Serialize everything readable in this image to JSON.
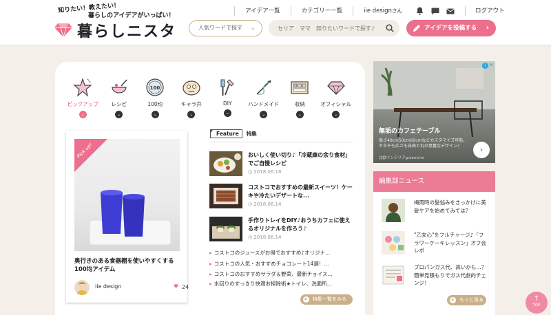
{
  "header": {
    "tagline1": "知りたい！教えたい！",
    "tagline2": "暮らしのアイデアがいっぱい！",
    "logo": "暮らしニスタ",
    "nav_ideas": "アイデア一覧",
    "nav_categories": "カテゴリー一覧",
    "user_name": "iie design",
    "user_suffix": "さん",
    "logout": "ログアウト",
    "keyword_select": "人気ワードで探す",
    "search_placeholder": "セリア　ママ　知りたいワードで探す♪",
    "post_button": "アイデアを投稿する"
  },
  "categories": [
    {
      "label": "ピックアップ",
      "icon": "pickup-star-icon",
      "active": true
    },
    {
      "label": "レシピ",
      "icon": "recipe-bowl-icon"
    },
    {
      "label": "100均",
      "icon": "100yen-icon"
    },
    {
      "label": "キャラ弁",
      "icon": "bento-icon"
    },
    {
      "label": "DIY",
      "icon": "diy-tools-icon"
    },
    {
      "label": "ハンドメイド",
      "icon": "handmade-needle-icon"
    },
    {
      "label": "収納",
      "icon": "storage-icon"
    },
    {
      "label": "オフィシャル",
      "icon": "official-gem-icon"
    }
  ],
  "pickup": {
    "ribbon": "Pick up!",
    "title": "奥行きのある食器棚を使いやすくする100均アイテム",
    "author": "iie design",
    "likes": "24"
  },
  "feature": {
    "badge": "Feature",
    "label": "特集",
    "articles": [
      {
        "title": "おいしく使い切り♪「冷蔵庫の余り食材」でご自慢レシピ",
        "date": "2018.06.18"
      },
      {
        "title": "コストコでおすすめの最新スイーツ！ケーキや冷たいデザートな...",
        "date": "2018.06.14"
      },
      {
        "title": "手作りトレイをDIY♪おうちカフェに使えるオリジナルを作ろう♪",
        "date": "2018.06.14"
      }
    ],
    "bullets": [
      "コストコのジュースがお得でおすすめ♪オリジナ...",
      "コストコの人気・おすすめチョコレート14選！...",
      "コストコのおすすめサラダ＆野菜、最新チョイス...",
      "水回りのすっきり快適お掃除術★トイレ、洗面所..."
    ],
    "more": "特集一覧をみる"
  },
  "ad": {
    "title": "無垢のカフェテーブル",
    "desc": "高さ40cm50cm60cmなどカスタマイズ可能。カタチも広さも自由と丸の意義なデザイン♪",
    "source": "北欧インテリアgreeniche"
  },
  "news": {
    "header": "編集部ニュース",
    "items": [
      {
        "text": "梅雨時の髪悩みをきっかけに美髪ケアを始めてみては？"
      },
      {
        "text": "\"乙女心\"をフルチャージ♪「フラワーケーキレッスン」オフ会レポ"
      },
      {
        "text": "プロパンガス代、高いかも…？簡単見積もりでガス代劇的チェンジ！"
      }
    ],
    "more": "もっと見る"
  },
  "top_button": "TOP"
}
